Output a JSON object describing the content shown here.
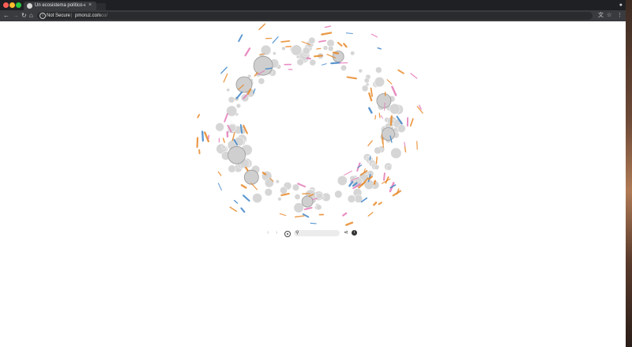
{
  "browser": {
    "tab": {
      "title": "Un ecosistema político-emp",
      "close": "×",
      "profile_icon": "person-icon"
    },
    "toolbar": {
      "back": "←",
      "forward": "→",
      "reload": "↻",
      "home": "⌂",
      "info_symbol": "i",
      "security_label": "Not Secure",
      "separator": "|",
      "url_host": "pmoruz.com",
      "url_path": "/eco/",
      "translate": "文",
      "star": "☆",
      "menu": "⋮"
    }
  },
  "viz_controls": {
    "prev": "‹",
    "next": "›",
    "search_icon": "🔍",
    "search_placeholder": "",
    "share": "⋖",
    "info": "i"
  },
  "colors": {
    "accent_orange": "#e8892a",
    "accent_pink": "#e47ab8",
    "accent_blue": "#3f86c9",
    "node_gray": "#d6d6d6"
  }
}
